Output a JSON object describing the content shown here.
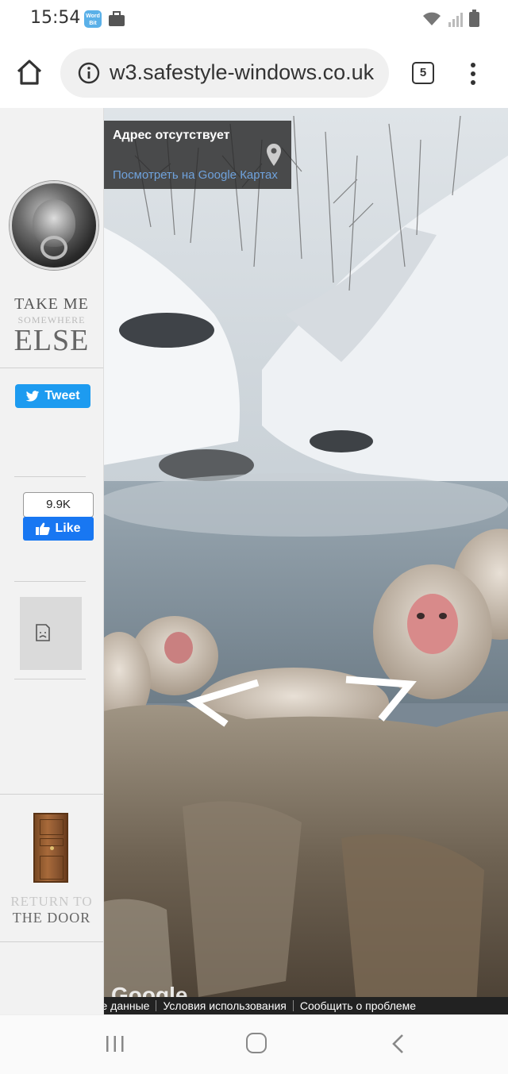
{
  "status_bar": {
    "time": "15:54",
    "app_icon_label": "Word\nBit"
  },
  "browser": {
    "url": "w3.safestyle-windows.co.uk",
    "tab_count": "5"
  },
  "sidebar": {
    "take_me": {
      "line1": "TAKE ME",
      "line2": "SOMEWHERE",
      "line3": "ELSE"
    },
    "tweet_label": "Tweet",
    "like_count": "9.9K",
    "like_label": "Like",
    "return": {
      "line1": "RETURN TO",
      "line2": "THE DOOR"
    }
  },
  "streetview": {
    "info_title": "Адрес отсутствует",
    "info_link": "Посмотреть на Google Картах",
    "google_logo": "Google",
    "footer": {
      "map_data": "Картографические данные",
      "terms": "Условия использования",
      "report": "Сообщить о проблеме"
    }
  }
}
